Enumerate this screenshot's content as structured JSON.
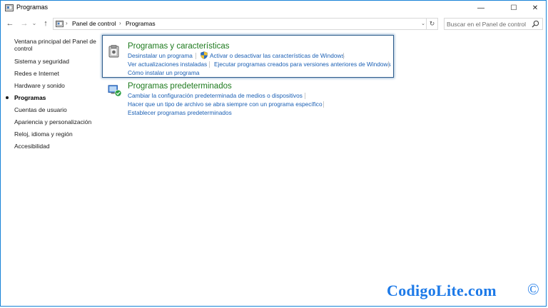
{
  "window": {
    "title": "Programas",
    "minimize": "—",
    "maximize": "☐",
    "close": "✕"
  },
  "nav": {
    "back": "←",
    "forward": "→",
    "dropdown": "⌄",
    "up": "↑",
    "breadcrumb": [
      "Panel de control",
      "Programas"
    ],
    "breadcrumb_sep": "›",
    "address_dropdown": "⌄",
    "refresh": "↻",
    "search_placeholder": "Buscar en el Panel de control"
  },
  "sidebar": {
    "items": [
      {
        "label": "Ventana principal del Panel de control",
        "active": false
      },
      {
        "label": "Sistema y seguridad",
        "active": false
      },
      {
        "label": "Redes e Internet",
        "active": false
      },
      {
        "label": "Hardware y sonido",
        "active": false
      },
      {
        "label": "Programas",
        "active": true
      },
      {
        "label": "Cuentas de usuario",
        "active": false
      },
      {
        "label": "Apariencia y personalización",
        "active": false
      },
      {
        "label": "Reloj, idioma y región",
        "active": false
      },
      {
        "label": "Accesibilidad",
        "active": false
      }
    ]
  },
  "sections": [
    {
      "title": "Programas y características",
      "icon": "programs-features-icon",
      "links": [
        "Desinstalar un programa",
        "Activar o desactivar las características de Windows",
        "Ver actualizaciones instaladas",
        "Ejecutar programas creados para versiones anteriores de Windows",
        "Cómo instalar un programa"
      ]
    },
    {
      "title": "Programas predeterminados",
      "icon": "default-programs-icon",
      "links": [
        "Cambiar la configuración predeterminada de medios o dispositivos",
        "Hacer que un tipo de archivo se abra siempre con un programa específico",
        "Establecer programas predeterminados"
      ]
    }
  ],
  "watermark": {
    "text": "CodigoLite.com",
    "symbol": "©"
  },
  "colors": {
    "accent_border": "#1883d7",
    "link": "#1a5fb4",
    "section_title": "#1e7a1e",
    "watermark": "#1d7ae8"
  }
}
